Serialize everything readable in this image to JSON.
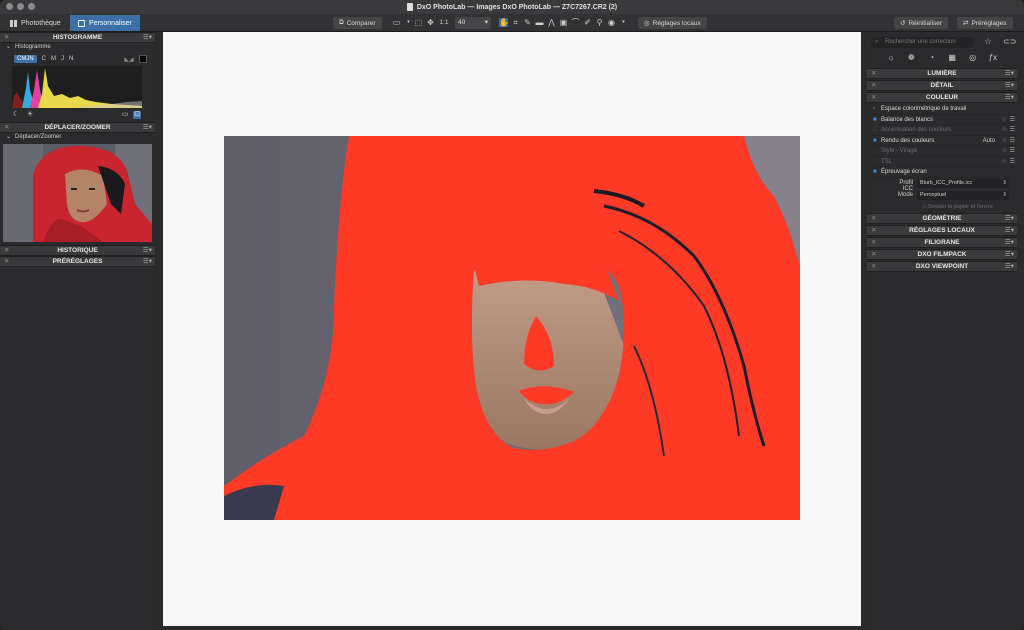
{
  "window": {
    "title": "DxO PhotoLab — Images DxO PhotoLab — Z7C7267.CR2 (2)"
  },
  "toolbar": {
    "tab_library": "Photothèque",
    "tab_customize": "Personnaliser",
    "compare_label": "Comparer",
    "ratio_label": "1:1",
    "zoom_value": "40",
    "local_adjust_label": "Réglages locaux",
    "reset_label": "Réinitialiser",
    "presets_label": "Préréglages"
  },
  "left_panel": {
    "histogram_header": "HISTOGRAMME",
    "histogram_sub": "Histogramme",
    "hist_tabs": [
      "CMJN",
      "C",
      "M",
      "J",
      "N"
    ],
    "move_zoom_header": "DÉPLACER/ZOOMER",
    "move_zoom_sub": "Déplacer/Zoomer",
    "history_header": "HISTORIQUE",
    "presets_header": "PRÉRÉGLAGES"
  },
  "right_panel": {
    "search_placeholder": "Rechercher une correction",
    "sections": {
      "lumiere": "LUMIÈRE",
      "detail": "DÉTAIL",
      "couleur": "COULEUR",
      "geometrie": "GÉOMÉTRIE",
      "reglages_locaux": "RÉGLAGES LOCAUX",
      "filigrane": "FILIGRANE",
      "filmpack": "DXO FILMPACK",
      "viewpoint": "DXO VIEWPOINT"
    },
    "couleur_items": {
      "espace": "Espace colorimétrique de travail",
      "balance": "Balance des blancs",
      "accentuation": "Accentuation des couleurs",
      "rendu": "Rendu des couleurs",
      "rendu_value": "Auto",
      "style": "Style - Virage",
      "tsl": "TSL",
      "epreuvage": "Épreuvage écran"
    },
    "fields": {
      "profil_label": "Profil ICC",
      "profil_value": "Blurb_ICC_Profile.icc",
      "mode_label": "Mode",
      "mode_value": "Perceptuel",
      "simulate": "Simuler le papier et l'encre"
    }
  },
  "colors": {
    "accent": "#3c6fa8",
    "gamut_warning": "#ff3b28",
    "canvas": "#f6f6f6"
  }
}
